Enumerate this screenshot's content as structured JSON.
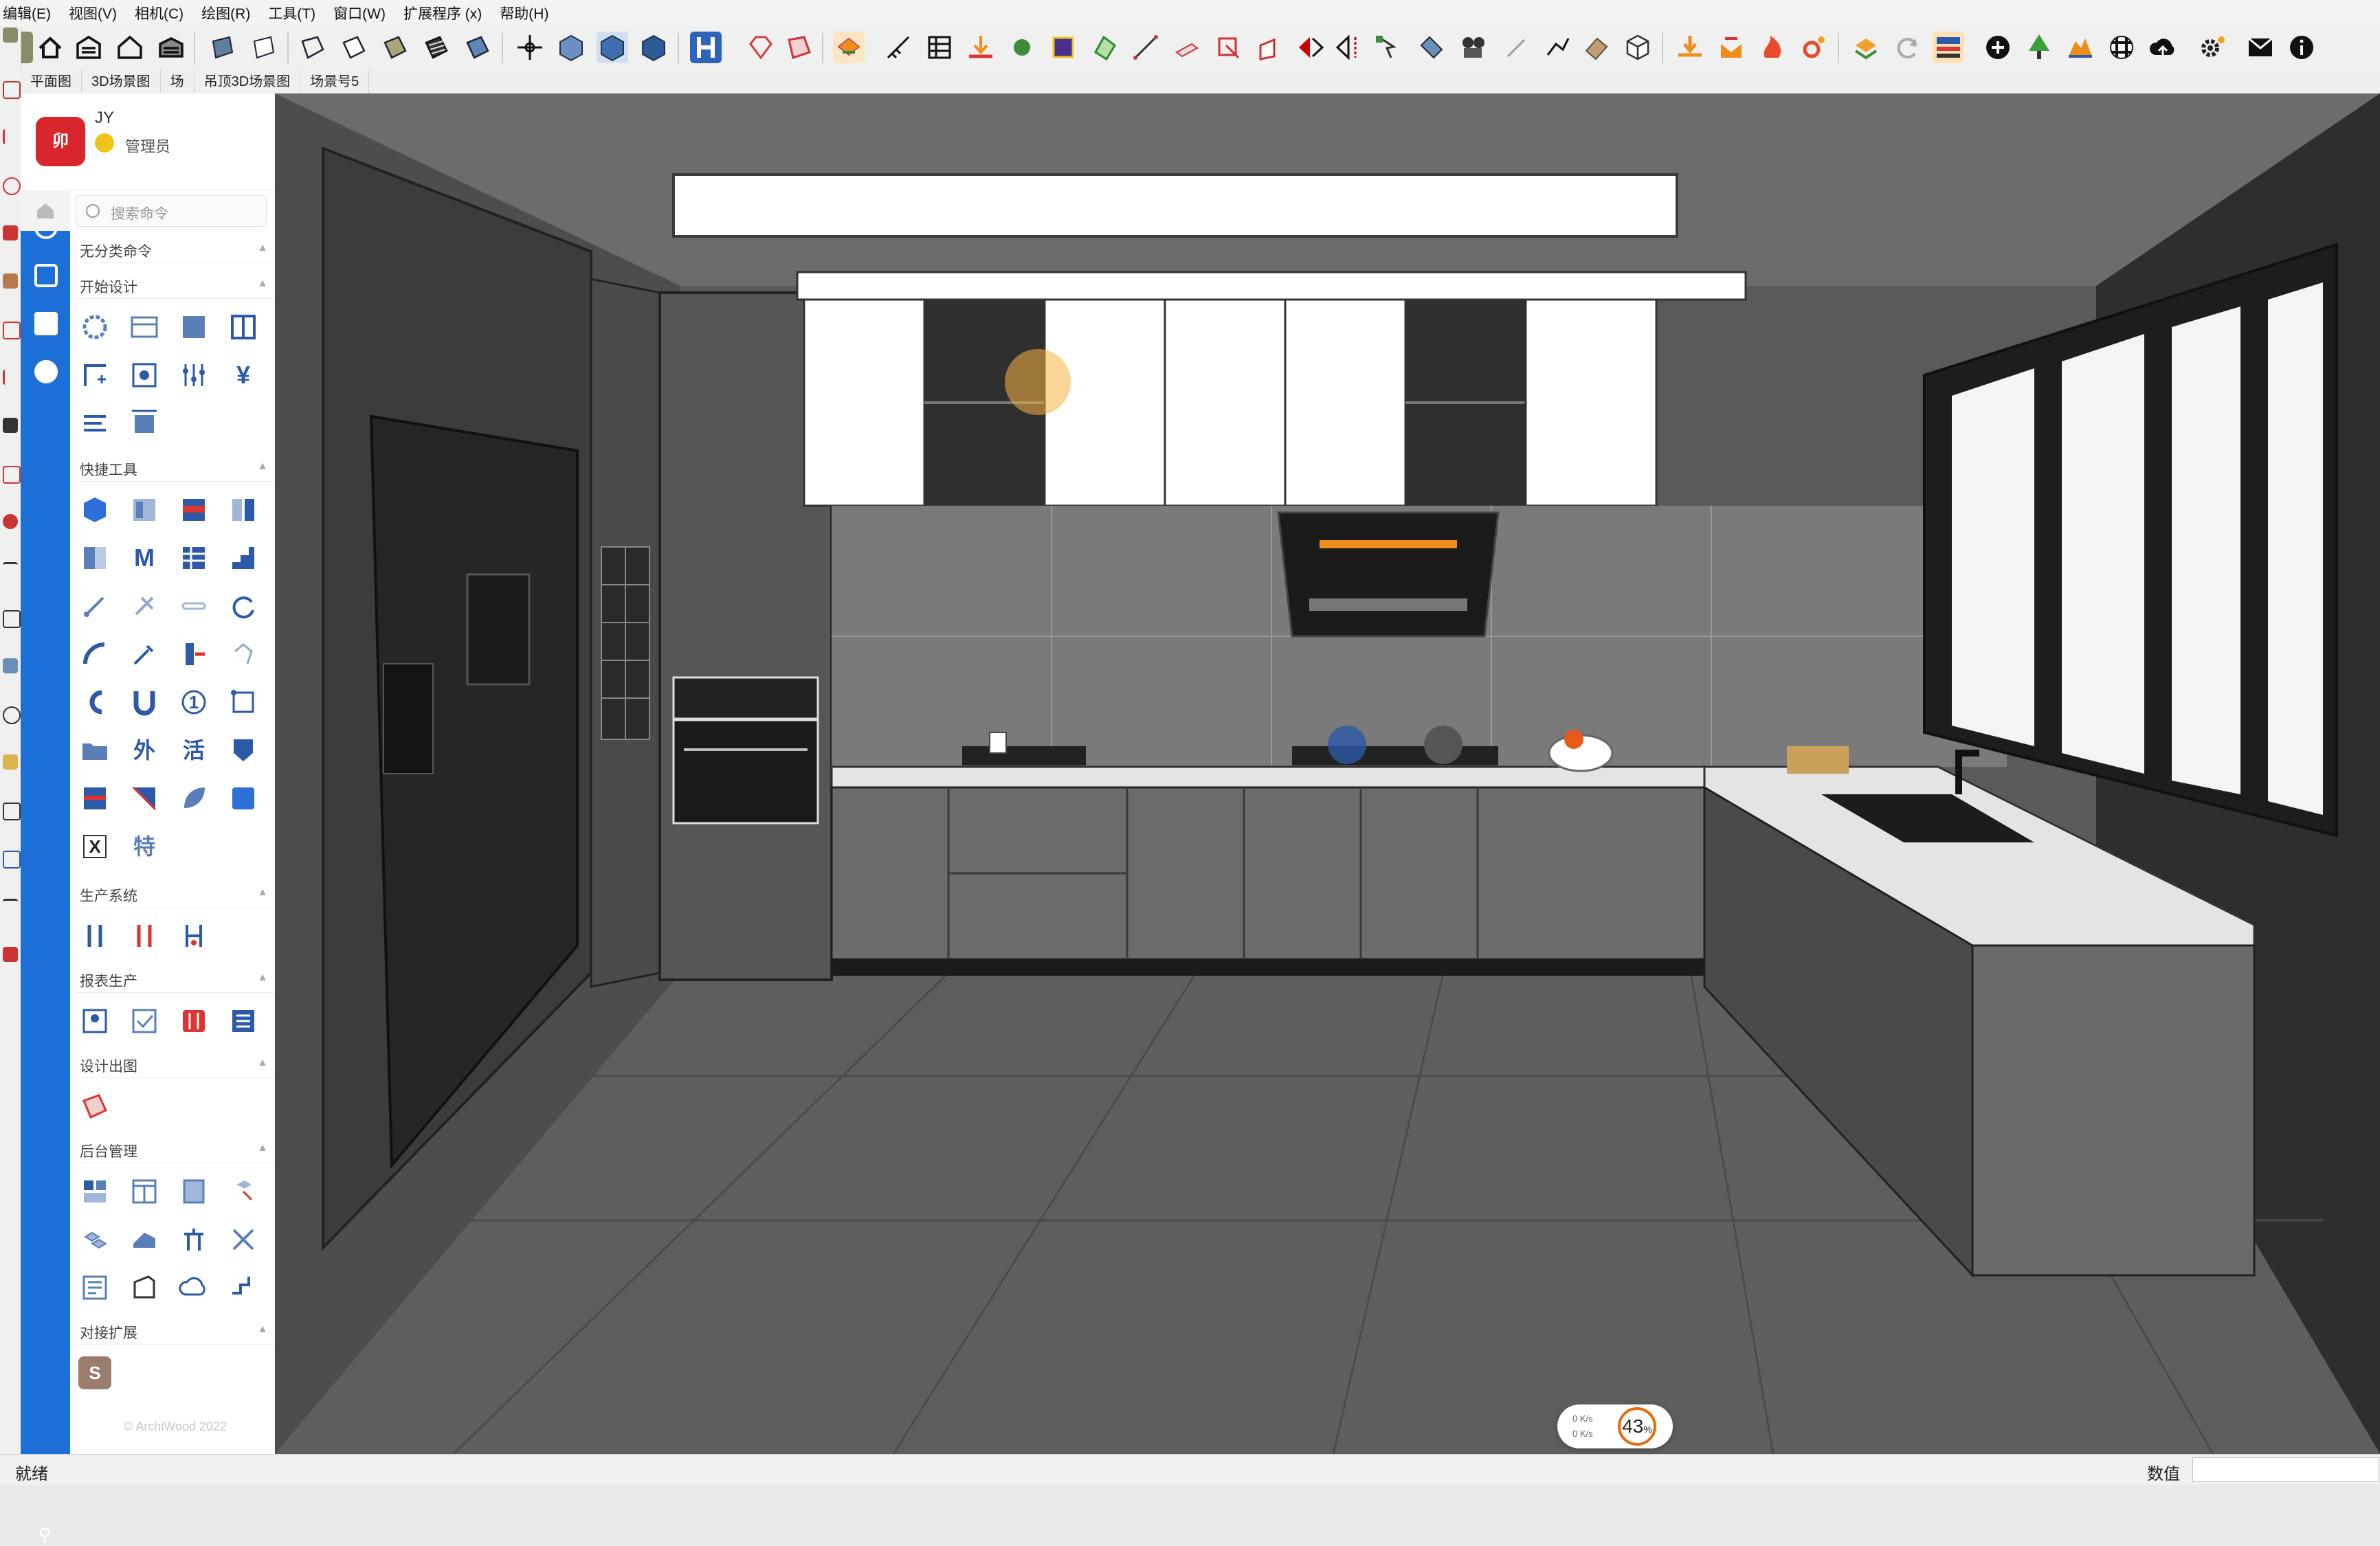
{
  "menubar": {
    "items": [
      "编辑(E)",
      "视图(V)",
      "相机(C)",
      "绘图(R)",
      "工具(T)",
      "窗口(W)",
      "扩展程序 (x)",
      "帮助(H)"
    ]
  },
  "tabs": [
    "平面图",
    "3D场景图",
    "场",
    "吊顶3D场景图",
    "场景号5"
  ],
  "sidebar": {
    "user": {
      "name": "JY",
      "role": "管理员",
      "logo_text": "卯"
    },
    "search_placeholder": "搜索命令",
    "sections": [
      {
        "label": "无分类命令"
      },
      {
        "label": "开始设计"
      },
      {
        "label": "快捷工具"
      },
      {
        "label": "生产系统"
      },
      {
        "label": "报表生产"
      },
      {
        "label": "设计出图"
      },
      {
        "label": "后台管理"
      },
      {
        "label": "对接扩展"
      }
    ],
    "glyph_icons": {
      "yuan": "¥",
      "m": "M",
      "wai": "外",
      "huo": "活",
      "te": "特",
      "excel": "X",
      "s": "S",
      "one": "1"
    },
    "copyright": "© ArchiWood 2022"
  },
  "viewport": {
    "scene": "kitchen-3d-render",
    "colors": {
      "wall": "#3a3a3a",
      "floor": "#5a5a5a",
      "cabinet_white": "#ffffff",
      "cabinet_grey": "#6c6c6c",
      "countertop": "#e4e4e4",
      "window": "#f4f4f4"
    }
  },
  "speed_widget": {
    "up": "0  K/s",
    "down": "0  K/s",
    "percent": "43",
    "percent_unit": "%"
  },
  "statusbar": {
    "text": "就绪",
    "measure_label": "数值",
    "measure_value": ""
  }
}
